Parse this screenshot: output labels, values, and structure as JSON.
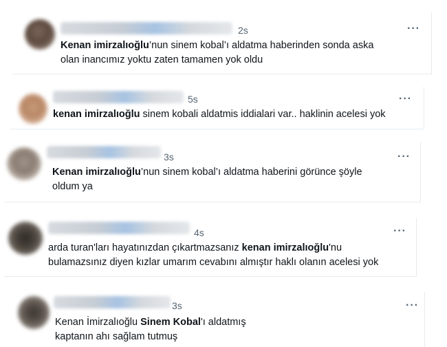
{
  "tweets": [
    {
      "time": "2s",
      "more": "···",
      "line1": {
        "bold": "Kenan imirzalıoğlu",
        "rest": "’nun sinem kobal’ı aldatma haberinden sonda aska"
      },
      "line2": "olan inancımız yoktu zaten tamamen yok oldu"
    },
    {
      "time": "5s",
      "more": "···",
      "line1": {
        "bold": "kenan imirzalıoğlu",
        "rest": " sinem kobali aldatmis iddialari var.. haklinin acelesi yok"
      }
    },
    {
      "time": "3s",
      "more": "···",
      "line1": {
        "bold": "Kenan imirzalıoğlu",
        "rest": "’nun sinem kobal’ı aldatma haberini görünce şöyle"
      },
      "line2": "oldum ya"
    },
    {
      "time": "4s",
      "more": "···",
      "line1": {
        "pre": "arda turan'ları hayatınızdan çıkartmazsanız ",
        "bold": "kenan imirzalıoğlu",
        "rest": "'nu"
      },
      "line2": "bulamazsınız diyen kızlar umarım cevabını almıştır haklı olanın acelesi yok"
    },
    {
      "time": "3s",
      "more": "···",
      "line1": {
        "pre": "Kenan İmirzalıoğlu ",
        "bold": "Sinem Kobal",
        "rest": "'ı aldatmış"
      },
      "line2": "kaptanın ahı sağlam tutmuş"
    }
  ]
}
